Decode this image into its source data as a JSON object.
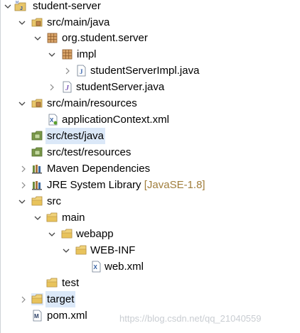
{
  "explorer": {
    "rows": [
      {
        "label": "student-server",
        "icon": "maven-project-icon",
        "twisty": "expanded"
      },
      {
        "label": "src/main/java",
        "icon": "source-folder-icon",
        "twisty": "expanded"
      },
      {
        "label": "org.student.server",
        "icon": "package-icon",
        "twisty": "expanded"
      },
      {
        "label": "impl",
        "icon": "package-icon",
        "twisty": "expanded"
      },
      {
        "label": "studentServerImpl.java",
        "icon": "java-file-icon",
        "twisty": "collapsed"
      },
      {
        "label": "studentServer.java",
        "icon": "java-interface-icon",
        "twisty": "collapsed"
      },
      {
        "label": "src/main/resources",
        "icon": "source-folder-icon",
        "twisty": "expanded"
      },
      {
        "label": "applicationContext.xml",
        "icon": "xml-file-icon",
        "twisty": "none"
      },
      {
        "label": "src/test/java",
        "icon": "test-source-folder-icon",
        "twisty": "none"
      },
      {
        "label": "src/test/resources",
        "icon": "test-source-folder-icon",
        "twisty": "none"
      },
      {
        "label": "Maven Dependencies",
        "icon": "library-icon",
        "twisty": "collapsed"
      },
      {
        "label": "JRE System Library",
        "decoration": "[JavaSE-1.8]",
        "icon": "library-icon",
        "twisty": "collapsed"
      },
      {
        "label": "src",
        "icon": "folder-icon",
        "twisty": "expanded"
      },
      {
        "label": "main",
        "icon": "folder-icon",
        "twisty": "expanded"
      },
      {
        "label": "webapp",
        "icon": "folder-icon",
        "twisty": "expanded"
      },
      {
        "label": "WEB-INF",
        "icon": "folder-icon",
        "twisty": "expanded"
      },
      {
        "label": "web.xml",
        "icon": "xml-file-icon",
        "twisty": "none"
      },
      {
        "label": "test",
        "icon": "folder-icon",
        "twisty": "none"
      },
      {
        "label": "target",
        "icon": "folder-icon",
        "twisty": "collapsed"
      },
      {
        "label": "pom.xml",
        "icon": "pom-file-icon",
        "twisty": "none"
      }
    ]
  },
  "watermark": "https://blog.csdn.net/qq_21040559",
  "colors": {
    "selection": "#dbe8f8",
    "folder": "#e8c66a",
    "package": "#c0854a",
    "library": "#6c8a3c",
    "decoration": "#a07d3b"
  }
}
